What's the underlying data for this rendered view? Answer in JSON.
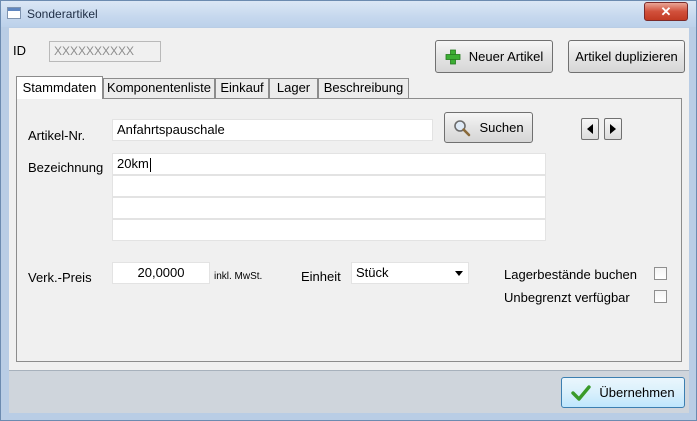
{
  "window": {
    "title": "Sonderartikel",
    "close_glyph": "✕"
  },
  "header": {
    "id_label": "ID",
    "id_value": "XXXXXXXXXX",
    "new_article_label": "Neuer Artikel",
    "duplicate_label": "Artikel duplizieren"
  },
  "tabs": [
    {
      "label": "Stammdaten",
      "active": true
    },
    {
      "label": "Komponentenliste",
      "active": false
    },
    {
      "label": "Einkauf",
      "active": false
    },
    {
      "label": "Lager",
      "active": false
    },
    {
      "label": "Beschreibung",
      "active": false
    }
  ],
  "form": {
    "article_no_label": "Artikel-Nr.",
    "article_no_value": "Anfahrtspauschale",
    "search_label": "Suchen",
    "designation_label": "Bezeichnung",
    "designation_lines": [
      "20km",
      "",
      "",
      ""
    ],
    "price_label": "Verk.-Preis",
    "price_value": "20,0000",
    "price_note": "inkl. MwSt.",
    "unit_label": "Einheit",
    "unit_value": "Stück",
    "stock_booking_label": "Lagerbestände buchen",
    "stock_booking_checked": false,
    "unlimited_label": "Unbegrenzt verfügbar",
    "unlimited_checked": false
  },
  "footer": {
    "apply_label": "Übernehmen"
  },
  "colors": {
    "plus_icon": "#3cae34",
    "check_icon": "#3a9a2a",
    "close_button": "#c9452e"
  }
}
